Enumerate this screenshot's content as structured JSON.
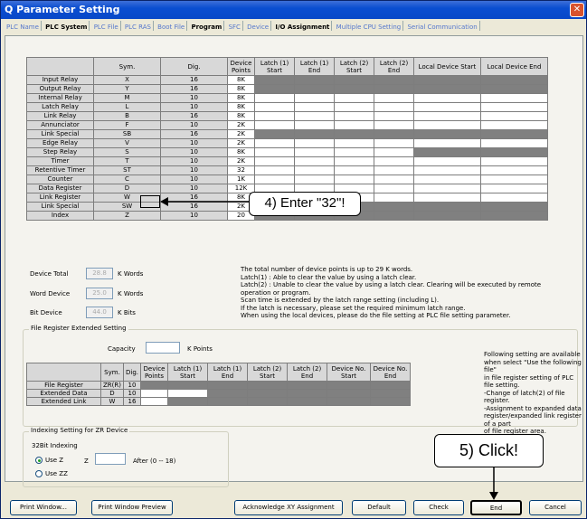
{
  "window": {
    "title": "Q Parameter Setting",
    "close": "✕"
  },
  "tabs": [
    "PLC Name",
    "PLC System",
    "PLC File",
    "PLC RAS",
    "Boot File",
    "Program",
    "SFC",
    "Device",
    "I/O Assignment",
    "Multiple CPU Setting",
    "Serial Communication"
  ],
  "device_table": {
    "headers": [
      "Sym.",
      "Dig.",
      "Device Points",
      "Latch (1) Start",
      "Latch (1) End",
      "Latch (2) Start",
      "Latch (2) End",
      "Local Device Start",
      "Local Device End"
    ],
    "rows": [
      {
        "name": "Input Relay",
        "sym": "X",
        "dig": "16",
        "points": "8K"
      },
      {
        "name": "Output Relay",
        "sym": "Y",
        "dig": "16",
        "points": "8K"
      },
      {
        "name": "Internal Relay",
        "sym": "M",
        "dig": "10",
        "points": "8K"
      },
      {
        "name": "Latch Relay",
        "sym": "L",
        "dig": "10",
        "points": "8K"
      },
      {
        "name": "Link Relay",
        "sym": "B",
        "dig": "16",
        "points": "8K"
      },
      {
        "name": "Annunciator",
        "sym": "F",
        "dig": "10",
        "points": "2K"
      },
      {
        "name": "Link Special",
        "sym": "SB",
        "dig": "16",
        "points": "2K"
      },
      {
        "name": "Edge Relay",
        "sym": "V",
        "dig": "10",
        "points": "2K"
      },
      {
        "name": "Step Relay",
        "sym": "S",
        "dig": "10",
        "points": "8K"
      },
      {
        "name": "Timer",
        "sym": "T",
        "dig": "10",
        "points": "2K"
      },
      {
        "name": "Retentive Timer",
        "sym": "ST",
        "dig": "10",
        "points": "32"
      },
      {
        "name": "Counter",
        "sym": "C",
        "dig": "10",
        "points": "1K"
      },
      {
        "name": "Data Register",
        "sym": "D",
        "dig": "10",
        "points": "12K"
      },
      {
        "name": "Link Register",
        "sym": "W",
        "dig": "16",
        "points": "8K"
      },
      {
        "name": "Link Special",
        "sym": "SW",
        "dig": "16",
        "points": "2K"
      },
      {
        "name": "Index",
        "sym": "Z",
        "dig": "10",
        "points": "20"
      }
    ]
  },
  "totals": {
    "device_total_label": "Device Total",
    "device_total": "28.8",
    "kwords": "K Words",
    "word_device_label": "Word Device",
    "word_device": "25.0",
    "kwords2": "K Words",
    "bit_device_label": "Bit Device",
    "bit_device": "44.0",
    "kbits": "K Bits"
  },
  "notes": [
    "The total number of device points is up to 29 K words.",
    "Latch(1) : Able to clear the value by using a latch clear.",
    "Latch(2) : Unable to clear the value by using a latch clear. Clearing will be executed by remote operation or program.",
    "Scan time is extended by the latch range setting (including L).",
    "If the latch is necessary, please set the required minimum latch range.",
    "When using the local devices, please do the file setting at PLC file setting parameter."
  ],
  "file_register": {
    "group_caption": "File Register Extended Setting",
    "capacity_label": "Capacity",
    "capacity_unit": "K Points",
    "headers": [
      "Sym.",
      "Dig.",
      "Device Points",
      "Latch (1) Start",
      "Latch (1) End",
      "Latch (2) Start",
      "Latch (2) End",
      "Device No. Start",
      "Device No. End"
    ],
    "rows": [
      {
        "name": "File Register",
        "sym": "ZR(R)",
        "dig": "10"
      },
      {
        "name": "Extended Data",
        "sym": "D",
        "dig": "10"
      },
      {
        "name": "Extended Link",
        "sym": "W",
        "dig": "16"
      }
    ],
    "side_note": [
      "Following setting are available",
      "when select \"Use the following file\"",
      "in file register setting of PLC file setting.",
      "-Change of latch(2) of file register.",
      "-Assignment to expanded data",
      "register/expanded link register of a part",
      "of file register area."
    ]
  },
  "indexing": {
    "group_caption": "Indexing Setting for ZR Device",
    "sub_label": "32Bit Indexing",
    "use_z": "Use Z",
    "z_label": "Z",
    "after_label": "After (0 -- 18)",
    "use_zz": "Use ZZ"
  },
  "buttons": {
    "print_window": "Print Window...",
    "print_preview": "Print Window Preview",
    "ack_xy": "Acknowledge XY Assignment",
    "default": "Default",
    "check": "Check",
    "end": "End",
    "cancel": "Cancel"
  },
  "callouts": {
    "enter": "4) Enter \"32\"!",
    "click": "5) Click!"
  }
}
